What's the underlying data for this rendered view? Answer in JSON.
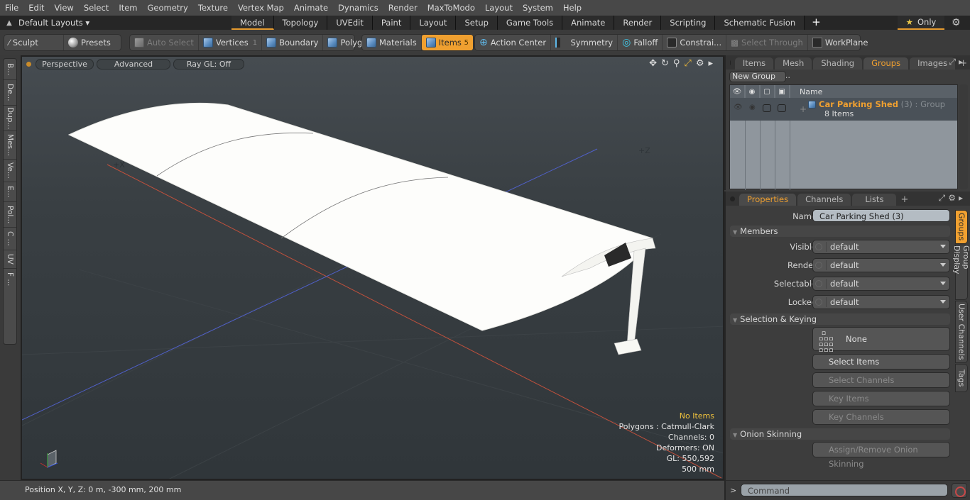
{
  "menubar": {
    "items": [
      "File",
      "Edit",
      "View",
      "Select",
      "Item",
      "Geometry",
      "Texture",
      "Vertex Map",
      "Animate",
      "Dynamics",
      "Render",
      "MaxToModo",
      "Layout",
      "System",
      "Help"
    ]
  },
  "layoutbar": {
    "layouts_label": "Default Layouts",
    "tabs": [
      {
        "label": "Model",
        "active": true
      },
      {
        "label": "Topology"
      },
      {
        "label": "UVEdit"
      },
      {
        "label": "Paint"
      },
      {
        "label": "Layout"
      },
      {
        "label": "Setup"
      },
      {
        "label": "Game Tools"
      },
      {
        "label": "Animate"
      },
      {
        "label": "Render"
      },
      {
        "label": "Scripting"
      },
      {
        "label": "Schematic Fusion"
      }
    ],
    "add_tab": "+",
    "only_label": "Only"
  },
  "toolbar": {
    "sculpt": "Sculpt",
    "presets": "Presets",
    "auto_select": "Auto Select",
    "vertices": "Vertices",
    "vertices_count": "1",
    "boundary": "Boundary",
    "polygons": "Polygons",
    "materials": "Materials",
    "items": "Items",
    "items_count": "5",
    "action_center": "Action Center",
    "symmetry": "Symmetry",
    "falloff": "Falloff",
    "constraints": "Constrai...",
    "select_through": "Select Through",
    "workplane": "WorkPlane"
  },
  "left_strip": {
    "tabs": [
      "B...",
      "De...",
      "Dup...",
      "Mes...",
      "Ve...",
      "E...",
      "Pol...",
      "C ...",
      "UV",
      "F ..."
    ]
  },
  "viewport": {
    "view_mode": "Perspective",
    "shading": "Advanced",
    "raygl": "Ray GL: Off",
    "axis_labels": {
      "x": "+X",
      "z": "+Z"
    },
    "hud": {
      "selection": "No Items",
      "polygons": "Polygons : Catmull-Clark",
      "channels": "Channels: 0",
      "deformers": "Deformers: ON",
      "gl": "GL: 550,592",
      "scale": "500 mm"
    }
  },
  "statusbar": {
    "position": "Position X, Y, Z:   0 m, -300 mm, 200 mm"
  },
  "groups_panel": {
    "tabs": [
      {
        "label": "Items"
      },
      {
        "label": "Mesh ..."
      },
      {
        "label": "Shading"
      },
      {
        "label": "Groups",
        "active": true
      },
      {
        "label": "Images"
      }
    ],
    "new_group": "New Group",
    "column_name": "Name",
    "rows": [
      {
        "name": "Car Parking Shed",
        "suffix": " (3)",
        "type": " : Group",
        "count": "8 Items"
      }
    ]
  },
  "properties_panel": {
    "tabs": [
      {
        "label": "Properties",
        "active": true
      },
      {
        "label": "Channels"
      },
      {
        "label": "Lists"
      }
    ],
    "name_label": "Name",
    "name_value": "Car Parking Shed (3)",
    "members_section": "Members",
    "members": [
      {
        "label": "Visible",
        "value": "default"
      },
      {
        "label": "Render",
        "value": "default"
      },
      {
        "label": "Selectable",
        "value": "default"
      },
      {
        "label": "Locked",
        "value": "default"
      }
    ],
    "selection_section": "Selection & Keying",
    "none_label": "None",
    "select_items": "Select Items",
    "select_channels": "Select Channels",
    "key_items": "Key Items",
    "key_channels": "Key Channels",
    "onion_section": "Onion Skinning",
    "onion_button": "Assign/Remove Onion Skinning",
    "side_tabs": [
      {
        "label": "Groups",
        "active": true
      },
      {
        "label": "Group Display"
      },
      {
        "label": "User Channels"
      },
      {
        "label": "Tags"
      }
    ]
  },
  "command": {
    "prompt": ">",
    "placeholder": "Command"
  },
  "colors": {
    "accent": "#f0a030",
    "x_axis": "#c0503c",
    "z_axis": "#5060c8"
  }
}
